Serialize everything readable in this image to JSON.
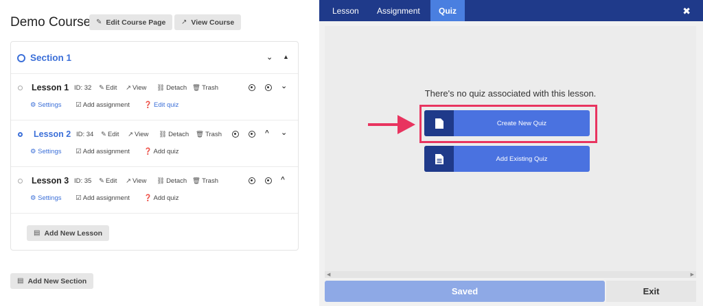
{
  "course": {
    "title": "Demo Course",
    "edit_page_label": "Edit Course Page",
    "view_course_label": "View Course"
  },
  "section": {
    "title": "Section 1"
  },
  "lessons": [
    {
      "name": "Lesson 1",
      "id": "ID: 32",
      "edit": "Edit",
      "view": "View",
      "detach": "Detach",
      "trash": "Trash",
      "settings": "Settings",
      "add_assignment": "Add assignment",
      "quiz": "Edit quiz"
    },
    {
      "name": "Lesson 2",
      "id": "ID: 34",
      "edit": "Edit",
      "view": "View",
      "detach": "Detach",
      "trash": "Trash",
      "settings": "Settings",
      "add_assignment": "Add assignment",
      "quiz": "Add quiz"
    },
    {
      "name": "Lesson 3",
      "id": "ID: 35",
      "edit": "Edit",
      "view": "View",
      "detach": "Detach",
      "trash": "Trash",
      "settings": "Settings",
      "add_assignment": "Add assignment",
      "quiz": "Add quiz"
    }
  ],
  "add_lesson_label": "Add New Lesson",
  "add_section_label": "Add New Section",
  "modal": {
    "tabs": [
      "Lesson",
      "Assignment",
      "Quiz"
    ],
    "active_tab": "Quiz",
    "message": "There's no quiz associated with this lesson.",
    "create_quiz_label": "Create New Quiz",
    "add_existing_label": "Add Existing Quiz",
    "saved_label": "Saved",
    "exit_label": "Exit"
  },
  "colors": {
    "brand_blue": "#3b6fd8",
    "header_navy": "#1f3a8a",
    "button_blue": "#4a72e0",
    "highlight_pink": "#e8345f"
  }
}
